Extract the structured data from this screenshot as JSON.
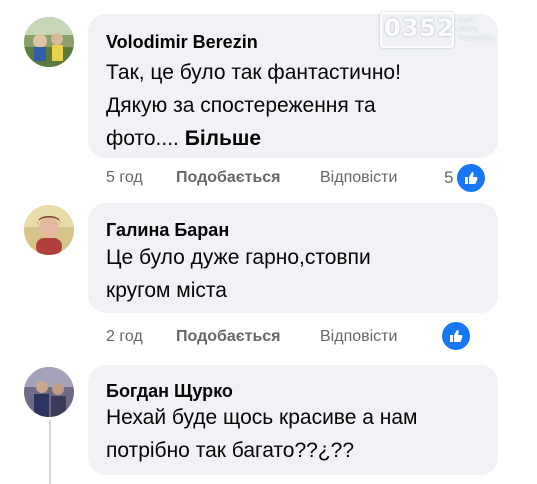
{
  "comments": [
    {
      "author": "Volodimir Berezin",
      "lines": [
        "Так, це було так фантастично!",
        "Дякую за спостереження та",
        "фото.... "
      ],
      "more_label": "Більше",
      "time": "5 год",
      "like_label": "Подобається",
      "reply_label": "Відповісти",
      "reaction_count": "5",
      "reaction_icon": "like-icon"
    },
    {
      "author": "Галина Баран",
      "lines": [
        "Це було дуже гарно,стовпи",
        "кругом міста"
      ],
      "time": "2 год",
      "like_label": "Подобається",
      "reply_label": "Відповісти",
      "reaction_icon": "like-icon"
    },
    {
      "author": "Богдан Щурко",
      "lines": [
        "Нехай буде щось красиве а нам",
        "потрібно так багато??¿??"
      ]
    }
  ],
  "watermark": {
    "number": "0352",
    "side_text": [
      "Сайт",
      "міста",
      "Тернопіль"
    ]
  },
  "colors": {
    "bubble": "#f0f2f5",
    "accent": "#1877f2",
    "meta": "#65676b"
  }
}
